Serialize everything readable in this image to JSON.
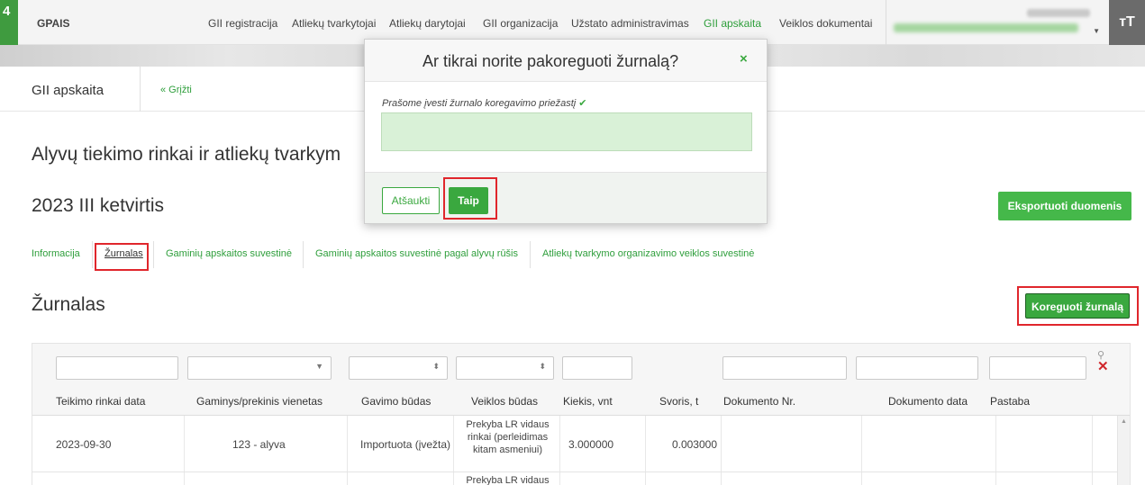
{
  "app": {
    "logo": "4",
    "brand": "GPAIS"
  },
  "nav": [
    {
      "label": "GII registracija"
    },
    {
      "label": "Atliekų tvarkytojai"
    },
    {
      "label": "Atliekų darytojai"
    },
    {
      "label": "GII organizacija"
    },
    {
      "label": "Užstato administravimas"
    },
    {
      "label": "GII apskaita"
    },
    {
      "label": "Veiklos dokumentai"
    }
  ],
  "user": {
    "font_button": "ᴛT"
  },
  "subbar": {
    "title": "GII apskaita",
    "back": "« Grįžti"
  },
  "page": {
    "heading": "Alyvų tiekimo rinkai ir atliekų tvarkym",
    "period": "2023 III ketvirtis",
    "export_button": "Eksportuoti duomenis"
  },
  "tabs": [
    {
      "label": "Informacija"
    },
    {
      "label": "Žurnalas"
    },
    {
      "label": "Gaminių apskaitos suvestinė"
    },
    {
      "label": "Gaminių apskaitos suvestinė pagal alyvų rūšis"
    },
    {
      "label": "Atliekų tvarkymo organizavimo veiklos suvestinė"
    }
  ],
  "journal": {
    "heading": "Žurnalas",
    "correct_button": "Koreguoti žurnalą"
  },
  "table": {
    "columns": [
      "Teikimo rinkai data",
      "Gaminys/prekinis vienetas",
      "Gavimo būdas",
      "Veiklos būdas",
      "Kiekis, vnt",
      "Svoris, t",
      "Dokumento Nr.",
      "Dokumento data",
      "Pastaba"
    ],
    "rows": [
      {
        "date": "2023-09-30",
        "product": "123 - alyva",
        "receipt": "Importuota (įvežta)",
        "activity_lines": [
          "Prekyba LR vidaus",
          "rinkai (perleidimas",
          "kitam asmeniui)"
        ],
        "quantity": "3.000000",
        "weight": "0.003000"
      },
      {
        "activity_partial": "Prekyba LR vidaus"
      }
    ]
  },
  "modal": {
    "title": "Ar tikrai norite pakoreguoti žurnalą?",
    "close": "×",
    "label": "Prašome įvesti žurnalo koregavimo priežastį",
    "check": "✔",
    "cancel": "Atšaukti",
    "confirm": "Taip"
  },
  "colors": {
    "accent": "#3aa83f",
    "highlight": "#e0262c"
  }
}
